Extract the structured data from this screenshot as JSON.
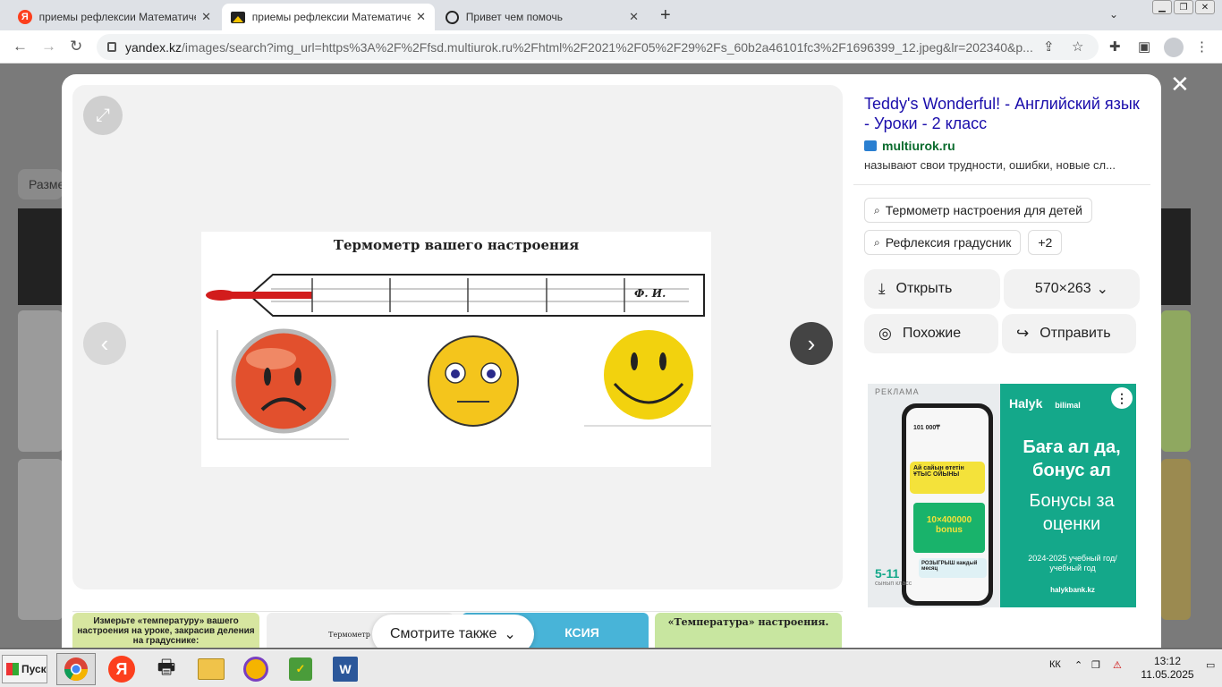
{
  "browser": {
    "tabs": [
      {
        "label": "приемы рефлексии Математическ",
        "close": "✕",
        "icon": "yandex-icon"
      },
      {
        "label": "приемы рефлексии Математическ",
        "close": "✕",
        "icon": "image-icon"
      },
      {
        "label": "Привет чем помочь",
        "close": "✕",
        "icon": "chatgpt-icon"
      }
    ],
    "new_tab": "+",
    "url_host": "yandex.kz",
    "url_path": "/images/search?img_url=https%3A%2F%2Ffsd.multiurok.ru%2Fhtml%2F2021%2F05%2F29%2Fs_60b2a46101fc3%2F1696399_12.jpeg&lr=202340&p..."
  },
  "background": {
    "chip_label": "Разме"
  },
  "viewer": {
    "image_title": "Термометр вашего настроения",
    "fio_label": "Ф. И.",
    "image_size": "570×263"
  },
  "info": {
    "title": "Teddy's Wonderful! - Английский язык - Уроки - 2 класс",
    "site": "multiurok.ru",
    "description": "называют свои трудности, ошибки, новые сл...",
    "chips": [
      "Термометр настроения для детей",
      "Рефлексия градусник"
    ],
    "more_chip": "+2",
    "open_label": "Открыть",
    "size_label": "570×263",
    "similar_label": "Похожие",
    "share_label": "Отправить"
  },
  "ad": {
    "label": "РЕКЛАМА",
    "brand": "Halyk",
    "brand2": "bilimal",
    "headline_kz": "Баға ал да, бонус ал",
    "headline_ru": "Бонусы за оценки",
    "year": "2024-2025 учебный год/учебный год",
    "url": "halykbank.kz",
    "grade": "5-11",
    "grade_sub": "сынып класс",
    "phone_amount": "101 000₸",
    "phone_card1": "Ай сайын өтетін ҰТЫС ОЙЫНЫ",
    "phone_bonus": "10×400000 bonus",
    "phone_card2": "РОЗЫГРЫШ каждый месяц"
  },
  "thumbnails": [
    {
      "text": "Измерьте «температуру» вашего настроения на уроке, закрасив деления на градуснике:",
      "bg": "#d7e6a0"
    },
    {
      "text": "Термометр ваше",
      "bg": "#eeeeee"
    },
    {
      "text": "КСИЯ",
      "bg": "#48b4d8"
    },
    {
      "text": "«Температура» настроения.",
      "bg": "#c8e6a0"
    }
  ],
  "see_also": "Смотрите также",
  "taskbar": {
    "start": "Пуск",
    "lang": "КК",
    "time": "13:12",
    "date": "11.05.2025"
  }
}
